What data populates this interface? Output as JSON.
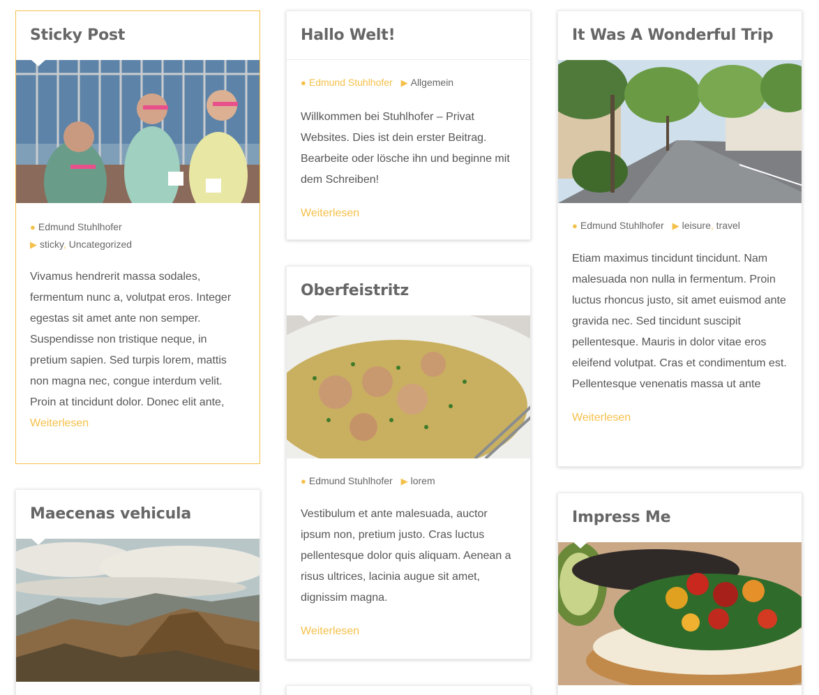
{
  "posts": [
    {
      "title": "Sticky Post",
      "author": "Edmund Stuhlhofer",
      "categories": [
        "sticky",
        "Uncategorized"
      ],
      "excerpt": "Vivamus hendrerit massa sodales, fermentum nunc a, volutpat eros. Integer egestas sit amet ante non semper. Suspendisse non tristique neque, in pretium sapien. Sed turpis lorem, mattis non magna nec, congue interdum velit. Proin at tincidunt dolor. Donec elit ante,",
      "more": "Weiterlesen",
      "image": "runners-photo"
    },
    {
      "title": "Hallo Welt!",
      "author": "Edmund Stuhlhofer",
      "categories": [
        "Allgemein"
      ],
      "excerpt": "Willkommen bei Stuhlhofer – Privat Websites. Dies ist dein erster Beitrag. Bearbeite oder lösche ihn und beginne mit dem Schreiben!",
      "more": "Weiterlesen"
    },
    {
      "title": "It Was A Wonderful Trip",
      "author": "Edmund Stuhlhofer",
      "categories": [
        "leisure",
        "travel"
      ],
      "excerpt": "Etiam maximus tincidunt tincidunt. Nam malesuada non nulla in fermentum. Proin luctus rhoncus justo, sit amet euismod ante gravida nec. Sed tincidunt suscipit pellentesque. Mauris in dolor vitae eros eleifend volutpat. Cras et condimentum est. Pellentesque venenatis massa ut ante",
      "more": "Weiterlesen",
      "image": "street-photo"
    },
    {
      "title": "Oberfeistritz",
      "author": "Edmund Stuhlhofer",
      "categories": [
        "lorem"
      ],
      "excerpt": "Vestibulum et ante malesuada, auctor ipsum non, pretium justo. Cras luctus pellentesque dolor quis aliquam. Aenean a risus ultrices, lacinia augue sit amet, dignissim magna.",
      "more": "Weiterlesen",
      "image": "soup-photo"
    },
    {
      "title": "Maecenas vehicula",
      "image": "mountains-photo"
    },
    {
      "title": "Impress Me",
      "image": "bruschetta-photo"
    }
  ],
  "colors": {
    "accent": "#f5c04a",
    "title": "#666666",
    "text": "#555555"
  }
}
